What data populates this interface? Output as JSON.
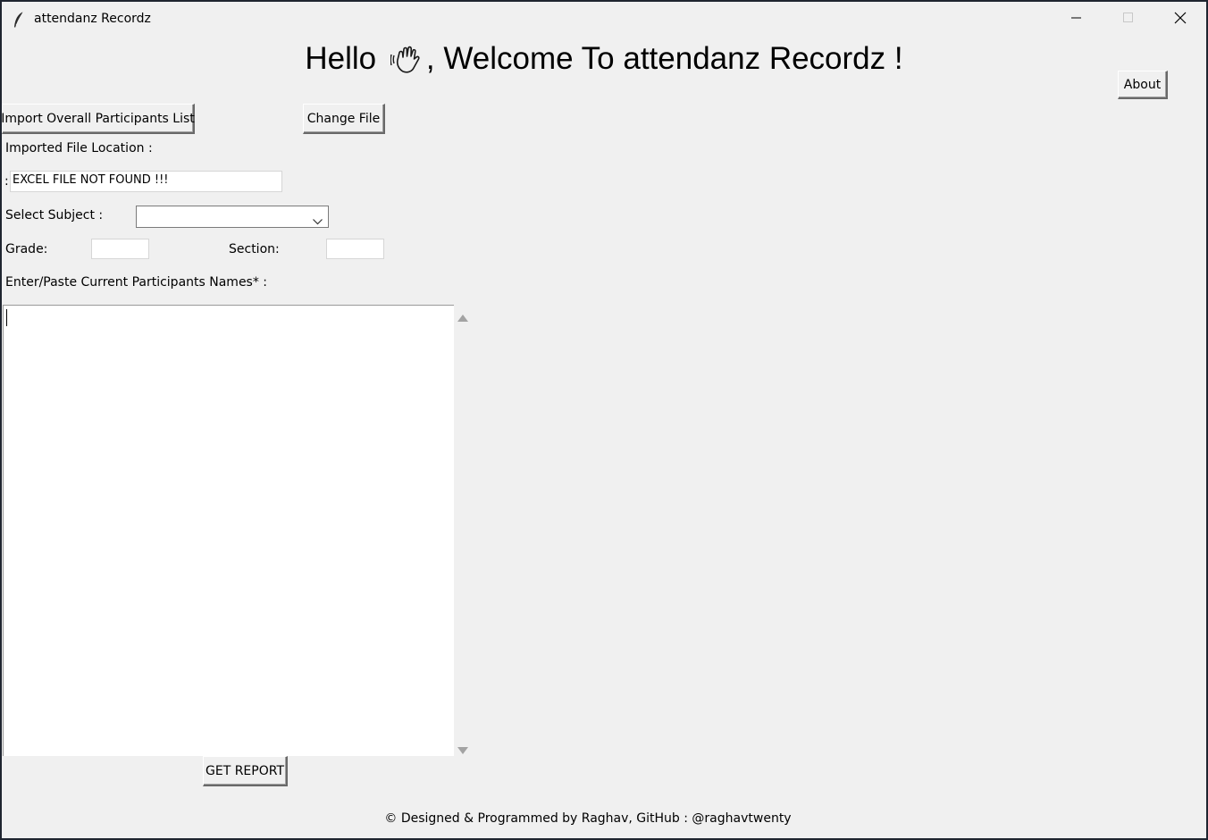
{
  "window": {
    "title": "attendanz Recordz",
    "icon": "feather-icon",
    "controls": [
      "minimize-icon",
      "maximize-icon",
      "close-icon"
    ]
  },
  "header": {
    "greeting_prefix": "Hello",
    "greeting_icon": "waving-hand-icon",
    "greeting_suffix": ", Welcome To attendanz Recordz !"
  },
  "buttons": {
    "about": "About",
    "import": "Import Overall Participants List",
    "change_file": "Change File",
    "get_report": "GET REPORT"
  },
  "form": {
    "imported_label": "Imported File Location :",
    "colon": ":",
    "file_value": "EXCEL FILE NOT FOUND !!!",
    "subject_label": "Select Subject :",
    "subject_value": "",
    "grade_label": "Grade:",
    "grade_value": "",
    "section_label": "Section:",
    "section_value": "",
    "names_label": "Enter/Paste Current Participants Names* :",
    "names_value": ""
  },
  "footer": {
    "text": "© Designed & Programmed by Raghav, GitHub : @raghavtwenty"
  }
}
